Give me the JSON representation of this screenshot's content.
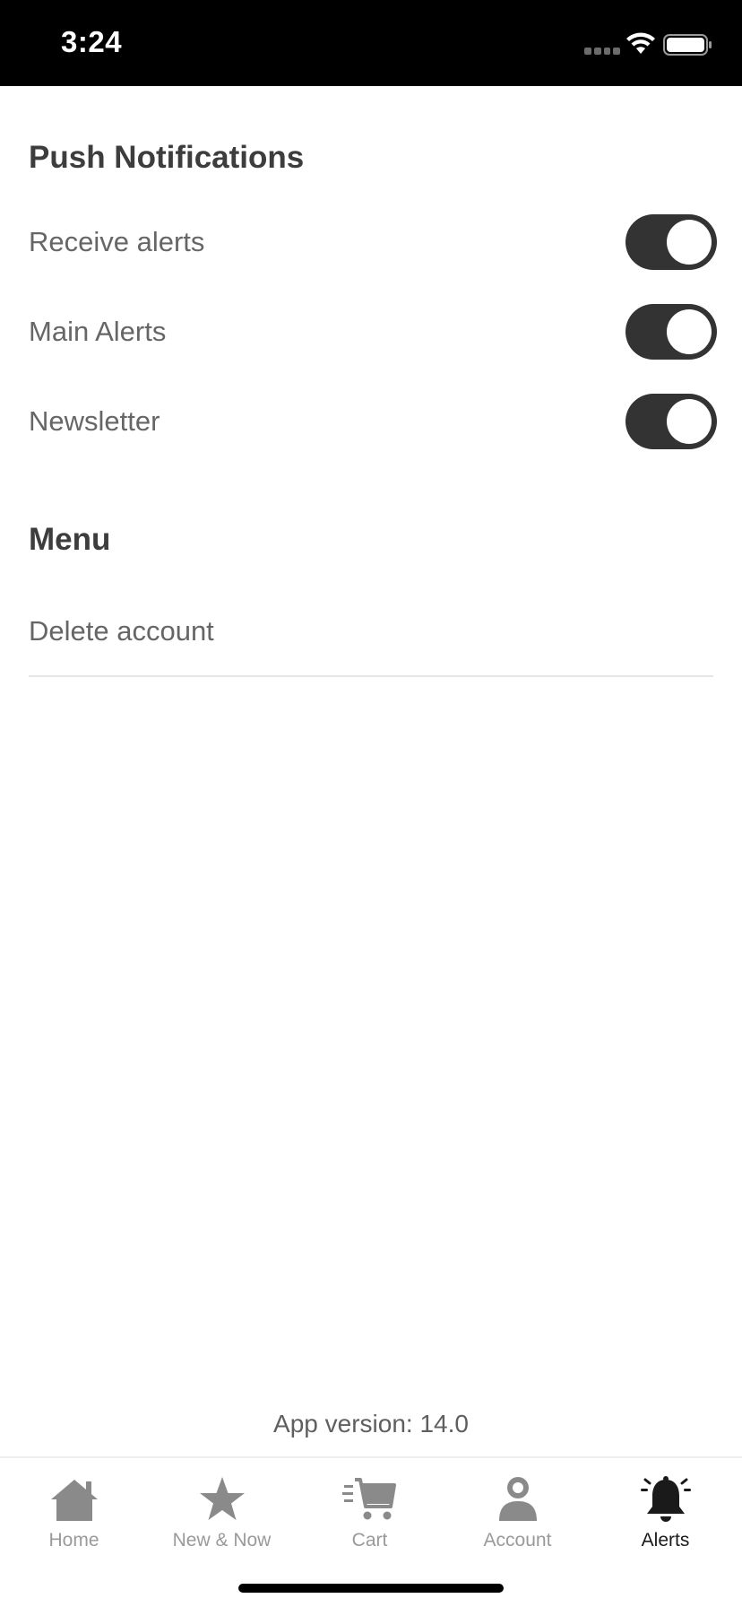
{
  "status_bar": {
    "time": "3:24"
  },
  "push_notifications": {
    "title": "Push Notifications",
    "items": [
      {
        "label": "Receive alerts",
        "enabled": true
      },
      {
        "label": "Main Alerts",
        "enabled": true
      },
      {
        "label": "Newsletter",
        "enabled": true
      }
    ]
  },
  "menu": {
    "title": "Menu",
    "items": [
      {
        "label": "Delete account"
      }
    ]
  },
  "footer": {
    "app_version": "App version: 14.0"
  },
  "tab_bar": {
    "tabs": [
      {
        "label": "Home",
        "icon": "home-icon",
        "active": false
      },
      {
        "label": "New & Now",
        "icon": "star-icon",
        "active": false
      },
      {
        "label": "Cart",
        "icon": "cart-icon",
        "active": false
      },
      {
        "label": "Account",
        "icon": "person-icon",
        "active": false
      },
      {
        "label": "Alerts",
        "icon": "bell-icon",
        "active": true
      }
    ]
  },
  "colors": {
    "toggle_on": "#333333",
    "text_primary": "#3d3d3d",
    "text_secondary": "#666666",
    "tab_inactive": "#9a9a9a",
    "tab_active": "#1a1a1a"
  }
}
